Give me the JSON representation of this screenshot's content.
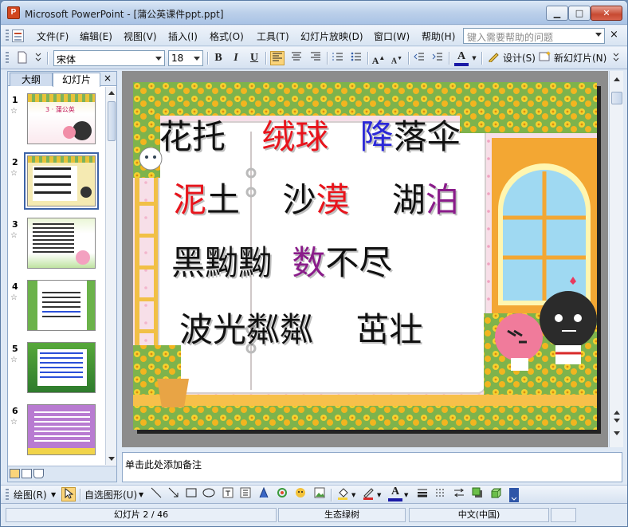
{
  "window": {
    "title": "Microsoft PowerPoint - [蒲公英课件ppt.ppt]",
    "app_icon_letter": "P",
    "minimize": "▁",
    "maximize": "□",
    "close": "✕"
  },
  "menu": {
    "items": [
      "文件(F)",
      "编辑(E)",
      "视图(V)",
      "插入(I)",
      "格式(O)",
      "工具(T)",
      "幻灯片放映(D)",
      "窗口(W)",
      "帮助(H)"
    ],
    "help_placeholder": "键入需要帮助的问题",
    "doc_close": "×"
  },
  "toolbar": {
    "font_name": "宋体",
    "font_size": "18",
    "bold": "B",
    "italic": "I",
    "underline": "U",
    "font_color_letter": "A",
    "design_label": "设计(S)",
    "new_slide_label": "新幻灯片(N)",
    "accent_color": "#fbd47a"
  },
  "left_pane": {
    "tab_outline": "大纲",
    "tab_slides": "幻灯片",
    "close": "×",
    "thumbnails": [
      {
        "number": "1",
        "star": "☆"
      },
      {
        "number": "2",
        "star": "☆"
      },
      {
        "number": "3",
        "star": "☆"
      },
      {
        "number": "4",
        "star": "☆"
      },
      {
        "number": "5",
        "star": "☆"
      },
      {
        "number": "6",
        "star": "☆"
      }
    ],
    "selected_slide": "2",
    "thumb1_title": "3 · 蒲公英"
  },
  "slide": {
    "lines": [
      [
        {
          "t": "花托",
          "c": "#111111"
        },
        {
          "t": "绒球",
          "c": "#e8141c"
        },
        {
          "t": "降",
          "c": "#2b28d8"
        },
        {
          "t": "落伞",
          "c": "#111111"
        }
      ],
      [
        {
          "t": "泥",
          "c": "#e8141c"
        },
        {
          "t": "土",
          "c": "#111111"
        },
        {
          "t": "沙",
          "c": "#111111"
        },
        {
          "t": "漠",
          "c": "#e8141c"
        },
        {
          "t": "湖",
          "c": "#111111"
        },
        {
          "t": "泊",
          "c": "#8a1c8a"
        }
      ],
      [
        {
          "t": "黑黝黝",
          "c": "#111111"
        },
        {
          "t": "数",
          "c": "#8a1c8a"
        },
        {
          "t": "不尽",
          "c": "#111111"
        }
      ],
      [
        {
          "t": "波光粼粼",
          "c": "#111111"
        },
        {
          "t": "茁壮",
          "c": "#111111"
        }
      ]
    ]
  },
  "notes": {
    "placeholder": "单击此处添加备注"
  },
  "drawbar": {
    "draw_label": "绘图(R)",
    "autoshape_label": "自选图形(U)"
  },
  "status": {
    "slide_info": "幻灯片 2 / 46",
    "design_name": "生态绿树",
    "language": "中文(中国)"
  }
}
